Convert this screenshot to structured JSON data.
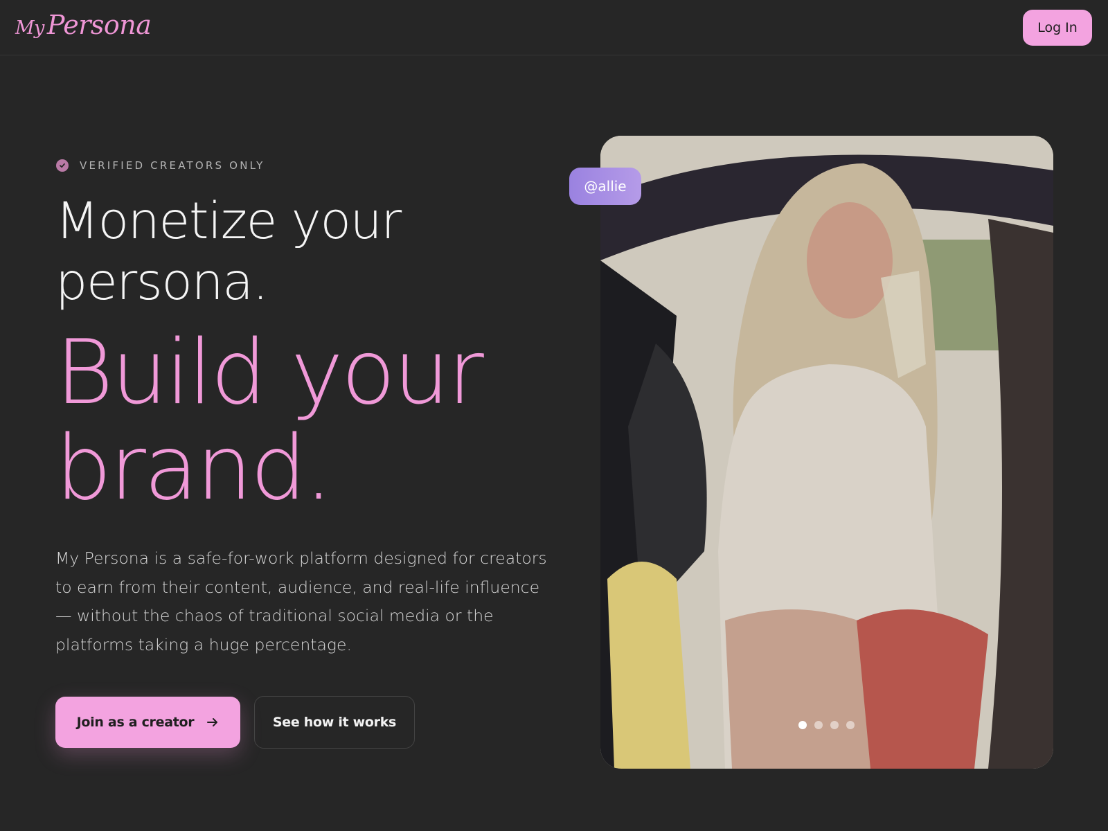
{
  "header": {
    "logo_my": "My",
    "logo_persona": "Persona",
    "login_label": "Log In"
  },
  "hero": {
    "eyebrow": "VERIFIED CREATORS ONLY",
    "headline_line1": "Monetize your",
    "headline_line2": "persona.",
    "accent_line1": "Build your",
    "accent_line2": "brand.",
    "description": "My Persona is a safe-for-work platform designed for creators to earn from their content, audience, and real-life influence — without the chaos of traditional social media or the platforms taking a huge percentage.",
    "cta_primary": "Join as a creator",
    "cta_secondary": "See how it works"
  },
  "carousel": {
    "handle": "@allie",
    "slide_count": 4,
    "active_index": 0
  },
  "colors": {
    "background": "#262626",
    "accent_pink": "#f3a3e0",
    "badge_purple": "#9a82e0",
    "text": "#f5f5f5"
  },
  "icons": {
    "eyebrow": "verified-check-icon",
    "cta": "arrow-right-icon"
  }
}
